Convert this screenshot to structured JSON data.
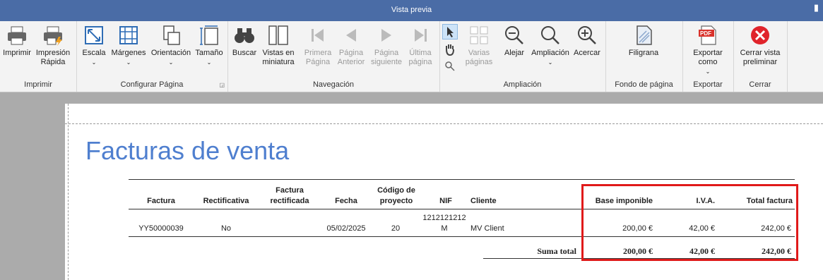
{
  "window": {
    "title": "Vista previa"
  },
  "ribbon": {
    "groups": {
      "imprimir": "Imprimir",
      "configurar": "Configurar Página",
      "navegacion": "Navegación",
      "ampliacion": "Ampliación",
      "fondo": "Fondo de página",
      "exportar": "Exportar",
      "cerrar": "Cerrar"
    },
    "buttons": {
      "imprimir": "Imprimir",
      "impresion_rapida": "Impresión Rápida",
      "escala": "Escala",
      "margenes": "Márgenes",
      "orientacion": "Orientación",
      "tamano": "Tamaño",
      "buscar": "Buscar",
      "vistas": "Vistas en miniatura",
      "primera": "Primera Página",
      "anterior": "Página Anterior",
      "siguiente": "Página siguiente",
      "ultima": "Última página",
      "varias": "Varias páginas",
      "alejar": "Alejar",
      "ampliacion": "Ampliación",
      "acercar": "Acercar",
      "filigrana": "Filigrana",
      "exportar": "Exportar como",
      "cerrar": "Cerrar vista preliminar"
    }
  },
  "report": {
    "title": "Facturas de venta",
    "headers": {
      "factura": "Factura",
      "rectificativa": "Rectificativa",
      "factura_rectificada": "Factura rectificada",
      "fecha": "Fecha",
      "codigo_proyecto": "Código de proyecto",
      "nif": "NIF",
      "cliente": "Cliente",
      "base": "Base imponible",
      "iva": "I.V.A.",
      "total": "Total factura"
    },
    "row": {
      "factura": "YY50000039",
      "rectificativa": "No",
      "fecha": "05/02/2025",
      "codigo": "20",
      "nif": "1212121212 M",
      "cliente": "MV Client",
      "base": "200,00 €",
      "iva": "42,00 €",
      "total": "242,00 €"
    },
    "summary": {
      "label": "Suma total",
      "base": "200,00 €",
      "iva": "42,00 €",
      "total": "242,00 €"
    }
  }
}
